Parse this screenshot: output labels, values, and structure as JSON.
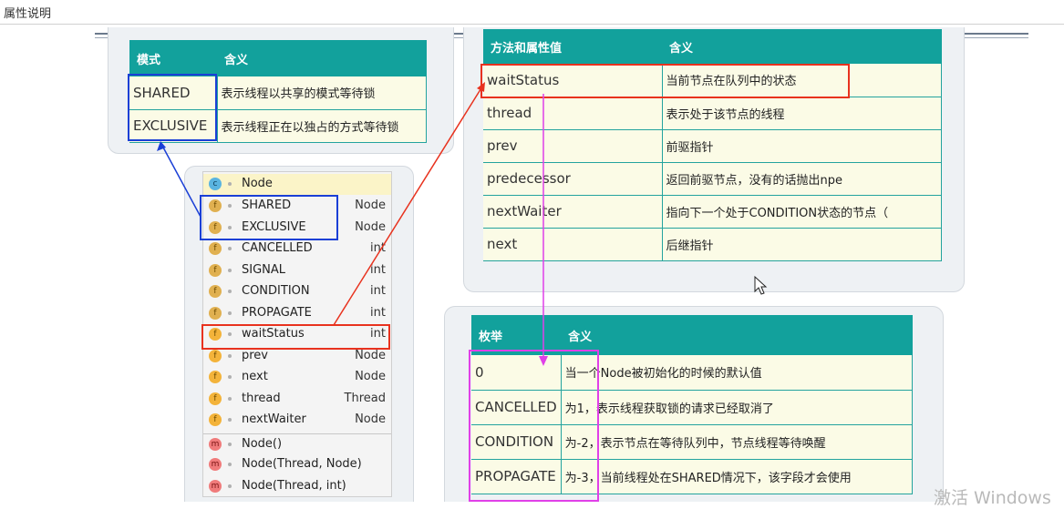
{
  "page": {
    "title": "属性说明",
    "watermark": "激活 Windows"
  },
  "mode_table": {
    "headers": [
      "模式",
      "含义"
    ],
    "rows": [
      [
        "SHARED",
        "表示线程以共享的模式等待锁"
      ],
      [
        "EXCLUSIVE",
        "表示线程正在以独占的方式等待锁"
      ]
    ]
  },
  "method_table": {
    "headers": [
      "方法和属性值",
      "含义"
    ],
    "rows": [
      [
        "waitStatus",
        "当前节点在队列中的状态"
      ],
      [
        "thread",
        "表示处于该节点的线程"
      ],
      [
        "prev",
        "前驱指针"
      ],
      [
        "predecessor",
        "返回前驱节点，没有的话抛出npe"
      ],
      [
        "nextWaiter",
        "指向下一个处于CONDITION状态的节点（"
      ],
      [
        "next",
        "后继指针"
      ]
    ]
  },
  "enum_table": {
    "headers": [
      "枚举",
      "含义"
    ],
    "rows": [
      [
        "0",
        "当一个Node被初始化的时候的默认值"
      ],
      [
        "CANCELLED",
        "为1，表示线程获取锁的请求已经取消了"
      ],
      [
        "CONDITION",
        "为-2，表示节点在等待队列中，节点线程等待唤醒"
      ],
      [
        "PROPAGATE",
        "为-3，当前线程处在SHARED情况下，该字段才会使用"
      ]
    ]
  },
  "node_structure": {
    "class_name": "Node",
    "members": [
      {
        "kind": "static-field",
        "icon": "f",
        "name": "SHARED",
        "type": "Node"
      },
      {
        "kind": "static-field",
        "icon": "f",
        "name": "EXCLUSIVE",
        "type": "Node"
      },
      {
        "kind": "static-field",
        "icon": "f",
        "name": "CANCELLED",
        "type": "int"
      },
      {
        "kind": "static-field",
        "icon": "f",
        "name": "SIGNAL",
        "type": "int"
      },
      {
        "kind": "static-field",
        "icon": "f",
        "name": "CONDITION",
        "type": "int"
      },
      {
        "kind": "static-field",
        "icon": "f",
        "name": "PROPAGATE",
        "type": "int"
      },
      {
        "kind": "field",
        "icon": "f",
        "name": "waitStatus",
        "type": "int"
      },
      {
        "kind": "field",
        "icon": "f",
        "name": "prev",
        "type": "Node"
      },
      {
        "kind": "field",
        "icon": "f",
        "name": "next",
        "type": "Node"
      },
      {
        "kind": "field",
        "icon": "f",
        "name": "thread",
        "type": "Thread"
      },
      {
        "kind": "field",
        "icon": "f",
        "name": "nextWaiter",
        "type": "Node"
      },
      {
        "kind": "method",
        "icon": "m",
        "name": "Node()",
        "type": ""
      },
      {
        "kind": "method",
        "icon": "m",
        "name": "Node(Thread, Node)",
        "type": ""
      },
      {
        "kind": "method",
        "icon": "m",
        "name": "Node(Thread, int)",
        "type": ""
      }
    ]
  },
  "colors": {
    "header_teal": "#12a19c",
    "cell_bg": "#fbfbe6",
    "highlight_blue": "#1a3fd6",
    "highlight_red": "#e8321e",
    "highlight_magenta": "#e040e8"
  }
}
